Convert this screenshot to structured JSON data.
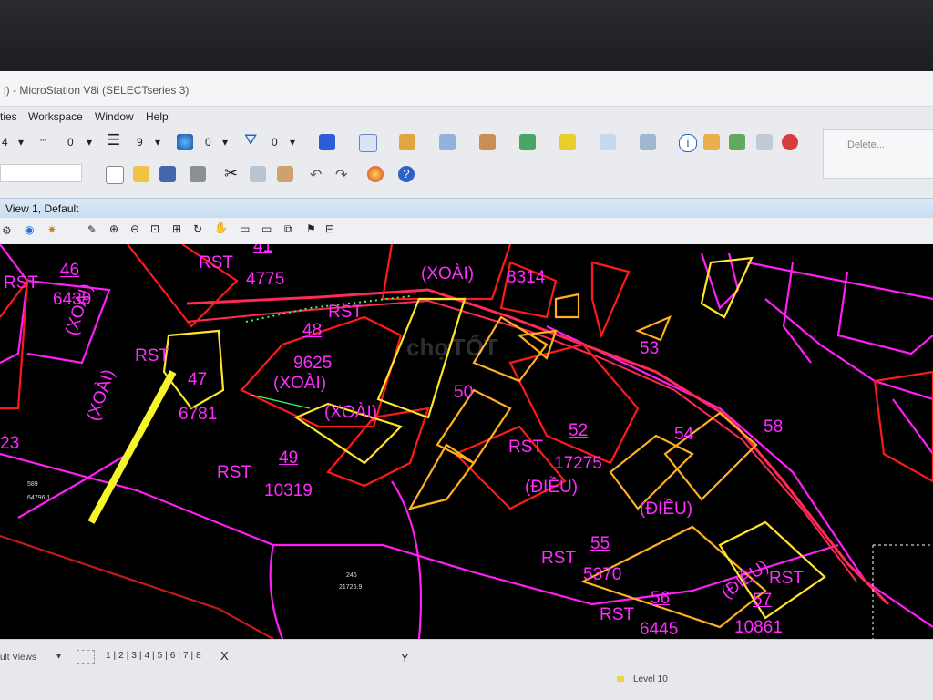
{
  "window": {
    "title": "i) - MicroStation V8i (SELECTseries 3)"
  },
  "menu": [
    "ties",
    "Workspace",
    "Window",
    "Help"
  ],
  "toolbar": {
    "weight1": "4",
    "weight2": "0",
    "lineweight": "9",
    "color": "0",
    "level": "0"
  },
  "task_panel": {
    "delete_label": "Delete..."
  },
  "view": {
    "title": "View 1, Default"
  },
  "map": {
    "parcels": [
      {
        "number": "46",
        "code": "RST",
        "area": "6439"
      },
      {
        "number": "41",
        "code": "RST",
        "area": "4775"
      },
      {
        "number": "",
        "code": "(XOÀI)",
        "area": "8314"
      },
      {
        "number": "48",
        "code": "RST",
        "area": "9625"
      },
      {
        "number": "47",
        "code": "RST",
        "area": "6781"
      },
      {
        "number": "49",
        "code": "RST",
        "area": "10319"
      },
      {
        "number": "52",
        "code": "RST",
        "area": "17275"
      },
      {
        "number": "55",
        "code": "RST",
        "area": "5370"
      },
      {
        "number": "56",
        "code": "RST",
        "area": "6445"
      },
      {
        "number": "57",
        "code": "RST",
        "area": "10861"
      }
    ],
    "standalone_numbers": [
      "53",
      "50",
      "54",
      "58",
      "23"
    ],
    "crop_tags": [
      "(XOÀI)",
      "(XOÀI)",
      "(XOÀI)",
      "(XOÀI)",
      "(ĐIỀU)",
      "(ĐIỀU)",
      "(ĐIỀU)"
    ],
    "watermark": "chợTỐT",
    "tiny_labels": {
      "a": "589",
      "b": "64796.1",
      "c": "246",
      "d": "21726.9"
    }
  },
  "status": {
    "views": "ult Views",
    "view_numbers": "1|2|3|4|5|6|7|8",
    "x_label": "X",
    "y_label": "Y",
    "level": "Level 10"
  }
}
